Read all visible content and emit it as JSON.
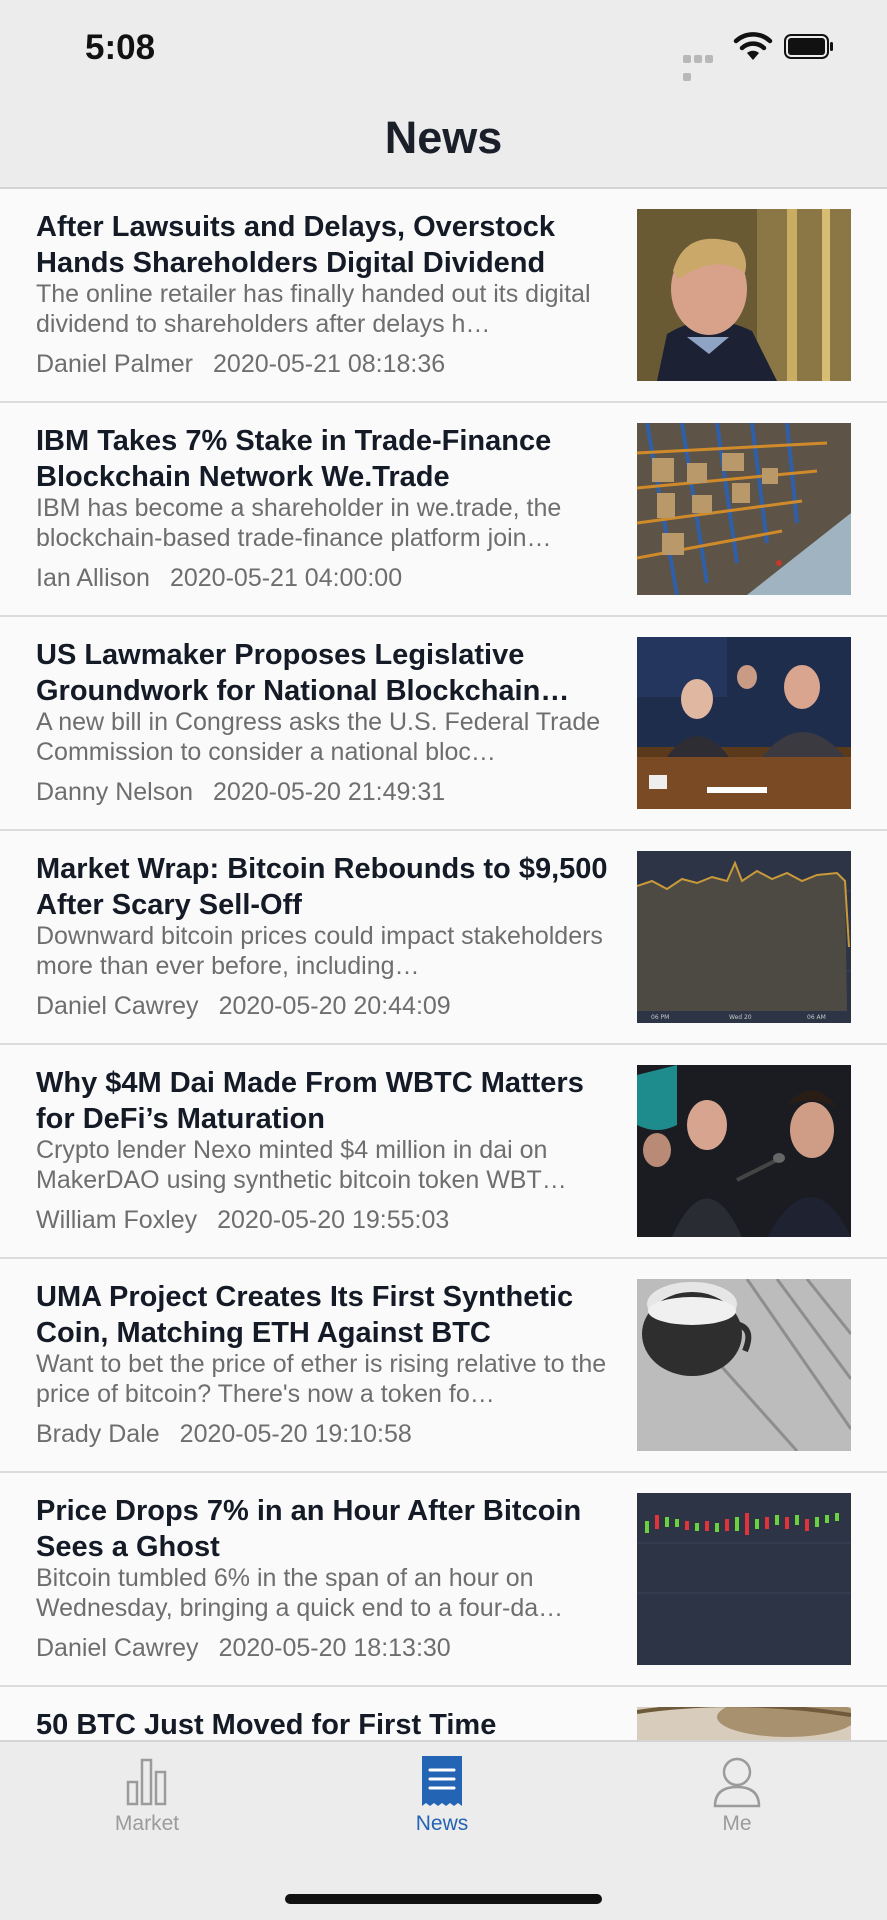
{
  "status_bar": {
    "time": "5:08"
  },
  "header": {
    "title": "News"
  },
  "articles": [
    {
      "title": "After Lawsuits and Delays, Overstock Hands Shareholders Digital Dividend",
      "summary": "The online retailer has finally handed out its digital dividend to shareholders after delays h…",
      "author": "Daniel Palmer",
      "date": "2020-05-21 08:18:36"
    },
    {
      "title": "IBM Takes 7% Stake in Trade-Finance Blockchain Network We.Trade",
      "summary": "IBM has become a shareholder in we.trade, the blockchain-based trade-finance platform join…",
      "author": "Ian Allison",
      "date": "2020-05-21 04:00:00"
    },
    {
      "title": "US Lawmaker Proposes Legislative Groundwork for National Blockchain…",
      "summary": "A new bill in Congress asks the U.S. Federal Trade Commission to consider a national bloc…",
      "author": "Danny Nelson",
      "date": "2020-05-20 21:49:31"
    },
    {
      "title": "Market Wrap: Bitcoin Rebounds to $9,500 After Scary Sell-Off",
      "summary": "Downward bitcoin prices could impact stakeholders more than ever before, including…",
      "author": "Daniel Cawrey",
      "date": "2020-05-20 20:44:09"
    },
    {
      "title": "Why $4M Dai Made From WBTC Matters for DeFi’s Maturation",
      "summary": "Crypto lender Nexo minted $4 million in dai on MakerDAO using synthetic bitcoin token WBT…",
      "author": "William Foxley",
      "date": "2020-05-20 19:55:03"
    },
    {
      "title": "UMA Project Creates Its First Synthetic Coin, Matching ETH Against BTC",
      "summary": "Want to bet the price of ether is rising relative to the price of bitcoin? There's now a token fo…",
      "author": "Brady Dale",
      "date": "2020-05-20 19:10:58"
    },
    {
      "title": "Price Drops 7% in an Hour After Bitcoin Sees a Ghost",
      "summary": "Bitcoin tumbled 6% in the span of an hour on Wednesday, bringing a quick end to a four-da…",
      "author": "Daniel Cawrey",
      "date": "2020-05-20 18:13:30"
    },
    {
      "title": "50 BTC Just Moved for First Time",
      "summary": "",
      "author": "",
      "date": ""
    }
  ],
  "thumb_chart_labels": [
    "06 PM",
    "Wed 20",
    "06 AM"
  ],
  "tabs": [
    {
      "label": "Market",
      "icon": "bar-chart-icon",
      "active": false
    },
    {
      "label": "News",
      "icon": "news-icon",
      "active": true
    },
    {
      "label": "Me",
      "icon": "person-icon",
      "active": false
    }
  ],
  "colors": {
    "accent": "#2464b4",
    "inactive": "#9b9b9b",
    "title_text": "#141a26",
    "secondary_text": "#6e6e6e"
  }
}
